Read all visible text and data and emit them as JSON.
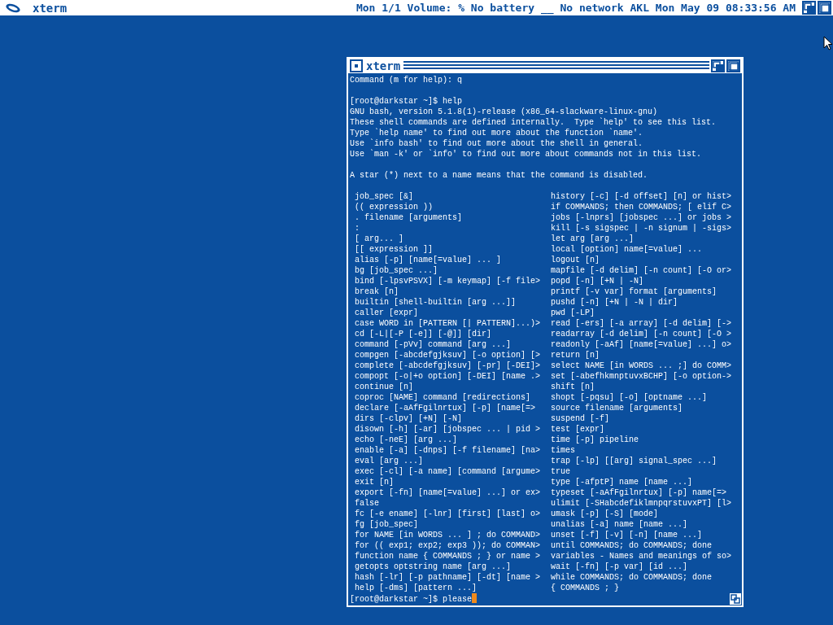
{
  "top_bar": {
    "app_title": "xterm",
    "status": "Mon 1/1 Volume: % No battery __ No network AKL Mon May 09 08:33:56 AM"
  },
  "window": {
    "title": "xterm"
  },
  "terminal": {
    "blocks": [
      [
        "Command (m for help): q"
      ],
      [
        "[root@darkstar ~]$ help",
        "GNU bash, version 5.1.8(1)-release (x86_64-slackware-linux-gnu)",
        "These shell commands are defined internally.  Type `help' to see this list.",
        "Type `help name' to find out more about the function `name'.",
        "Use `info bash' to find out more about the shell in general.",
        "Use `man -k' or `info' to find out more about commands not in this list."
      ],
      [
        "A star (*) next to a name means that the command is disabled."
      ]
    ],
    "help_rows": [
      {
        "left": "job_spec [&]",
        "right": "history [-c] [-d offset] [n] or hist>"
      },
      {
        "left": "(( expression ))",
        "right": "if COMMANDS; then COMMANDS; [ elif C>"
      },
      {
        "left": ". filename [arguments]",
        "right": "jobs [-lnprs] [jobspec ...] or jobs >"
      },
      {
        "left": ":",
        "right": "kill [-s sigspec | -n signum | -sigs>"
      },
      {
        "left": "[ arg... ]",
        "right": "let arg [arg ...]"
      },
      {
        "left": "[[ expression ]]",
        "right": "local [option] name[=value] ..."
      },
      {
        "left": "alias [-p] [name[=value] ... ]",
        "right": "logout [n]"
      },
      {
        "left": "bg [job_spec ...]",
        "right": "mapfile [-d delim] [-n count] [-O or>"
      },
      {
        "left": "bind [-lpsvPSVX] [-m keymap] [-f file>",
        "right": "popd [-n] [+N | -N]"
      },
      {
        "left": "break [n]",
        "right": "printf [-v var] format [arguments]"
      },
      {
        "left": "builtin [shell-builtin [arg ...]]",
        "right": "pushd [-n] [+N | -N | dir]"
      },
      {
        "left": "caller [expr]",
        "right": "pwd [-LP]"
      },
      {
        "left": "case WORD in [PATTERN [| PATTERN]...)>",
        "right": "read [-ers] [-a array] [-d delim] [->"
      },
      {
        "left": "cd [-L|[-P [-e]] [-@]] [dir]",
        "right": "readarray [-d delim] [-n count] [-O >"
      },
      {
        "left": "command [-pVv] command [arg ...]",
        "right": "readonly [-aAf] [name[=value] ...] o>"
      },
      {
        "left": "compgen [-abcdefgjksuv] [-o option] [>",
        "right": "return [n]"
      },
      {
        "left": "complete [-abcdefgjksuv] [-pr] [-DEI]>",
        "right": "select NAME [in WORDS ... ;] do COMM>"
      },
      {
        "left": "compopt [-o|+o option] [-DEI] [name .>",
        "right": "set [-abefhkmnptuvxBCHP] [-o option->"
      },
      {
        "left": "continue [n]",
        "right": "shift [n]"
      },
      {
        "left": "coproc [NAME] command [redirections]",
        "right": "shopt [-pqsu] [-o] [optname ...]"
      },
      {
        "left": "declare [-aAfFgilnrtux] [-p] [name[=>",
        "right": "source filename [arguments]"
      },
      {
        "left": "dirs [-clpv] [+N] [-N]",
        "right": "suspend [-f]"
      },
      {
        "left": "disown [-h] [-ar] [jobspec ... | pid >",
        "right": "test [expr]"
      },
      {
        "left": "echo [-neE] [arg ...]",
        "right": "time [-p] pipeline"
      },
      {
        "left": "enable [-a] [-dnps] [-f filename] [na>",
        "right": "times"
      },
      {
        "left": "eval [arg ...]",
        "right": "trap [-lp] [[arg] signal_spec ...]"
      },
      {
        "left": "exec [-cl] [-a name] [command [argume>",
        "right": "true"
      },
      {
        "left": "exit [n]",
        "right": "type [-afptP] name [name ...]"
      },
      {
        "left": "export [-fn] [name[=value] ...] or ex>",
        "right": "typeset [-aAfFgilnrtux] [-p] name[=>"
      },
      {
        "left": "false",
        "right": "ulimit [-SHabcdefiklmnpqrstuvxPT] [l>"
      },
      {
        "left": "fc [-e ename] [-lnr] [first] [last] o>",
        "right": "umask [-p] [-S] [mode]"
      },
      {
        "left": "fg [job_spec]",
        "right": "unalias [-a] name [name ...]"
      },
      {
        "left": "for NAME [in WORDS ... ] ; do COMMAND>",
        "right": "unset [-f] [-v] [-n] [name ...]"
      },
      {
        "left": "for (( exp1; exp2; exp3 )); do COMMAN>",
        "right": "until COMMANDS; do COMMANDS; done"
      },
      {
        "left": "function name { COMMANDS ; } or name >",
        "right": "variables - Names and meanings of so>"
      },
      {
        "left": "getopts optstring name [arg ...]",
        "right": "wait [-fn] [-p var] [id ...]"
      },
      {
        "left": "hash [-lr] [-p pathname] [-dt] [name >",
        "right": "while COMMANDS; do COMMANDS; done"
      },
      {
        "left": "help [-dms] [pattern ...]",
        "right": "{ COMMANDS ; }"
      }
    ],
    "prompt": "[root@darkstar ~]$ please"
  }
}
